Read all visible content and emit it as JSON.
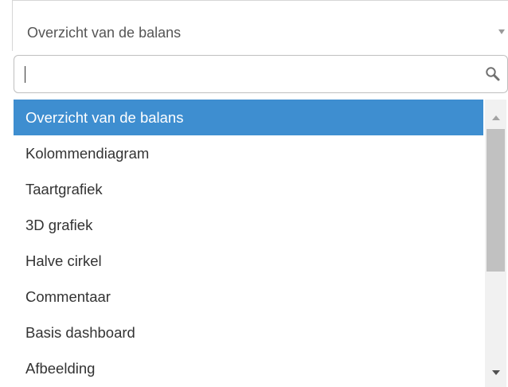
{
  "select": {
    "selected_value": "Overzicht van de balans"
  },
  "search": {
    "value": "",
    "placeholder": ""
  },
  "options": [
    {
      "label": "Overzicht van de balans",
      "selected": true
    },
    {
      "label": "Kolommendiagram",
      "selected": false
    },
    {
      "label": "Taartgrafiek",
      "selected": false
    },
    {
      "label": "3D grafiek",
      "selected": false
    },
    {
      "label": "Halve cirkel",
      "selected": false
    },
    {
      "label": "Commentaar",
      "selected": false
    },
    {
      "label": "Basis dashboard",
      "selected": false
    },
    {
      "label": "Afbeelding",
      "selected": false
    }
  ],
  "colors": {
    "selected_background": "#3e8ed0",
    "selected_text": "#ffffff",
    "option_text": "#333333"
  },
  "icons": {
    "dropdown": "caret-down-icon",
    "search": "search-icon",
    "scroll_up": "scroll-up-arrow-icon",
    "scroll_down": "scroll-down-arrow-icon"
  }
}
